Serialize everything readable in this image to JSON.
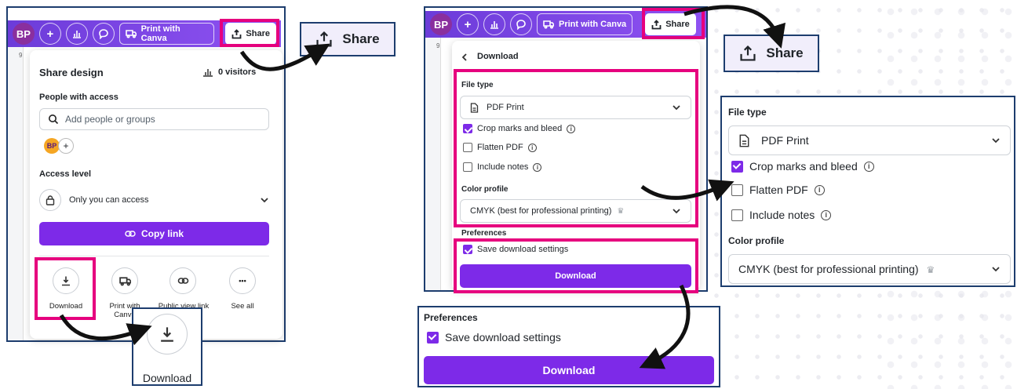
{
  "colors": {
    "accent": "#7d2ae8",
    "highlight": "#e6007e",
    "frame": "#1d3d6e",
    "topbar": "#7345e0"
  },
  "topbar": {
    "avatar": "BP",
    "add": "+",
    "print_label": "Print with Canva",
    "share_label": "Share"
  },
  "ruler_mark": "9",
  "share_panel": {
    "title": "Share design",
    "visitors": "0 visitors",
    "people_heading": "People with access",
    "search_placeholder": "Add people or groups",
    "chip_initials": "BP",
    "chip_add": "+",
    "access_heading": "Access level",
    "access_value": "Only you can access",
    "copy_link": "Copy link",
    "options": [
      {
        "label": "Download",
        "icon": "download-icon"
      },
      {
        "label": "Print with Canva",
        "icon": "truck-icon"
      },
      {
        "label": "Public view link",
        "icon": "link-icon"
      },
      {
        "label": "See all",
        "icon": "more-icon"
      }
    ]
  },
  "zoom_download": {
    "label": "Download"
  },
  "zoom_share": {
    "label": "Share"
  },
  "download_panel": {
    "title": "Download",
    "file_type_heading": "File type",
    "file_type_value": "PDF Print",
    "crop_marks": "Crop marks and bleed",
    "flatten_pdf": "Flatten PDF",
    "include_notes": "Include notes",
    "color_profile_heading": "Color profile",
    "color_profile_value": "CMYK (best for professional printing)",
    "preferences_heading": "Preferences",
    "save_settings": "Save download settings",
    "download_button": "Download",
    "crop_marks_checked": true,
    "flatten_pdf_checked": false,
    "include_notes_checked": false,
    "save_settings_checked": true
  },
  "zoom_file_type": {
    "heading": "File type",
    "value": "PDF Print",
    "crop_marks": "Crop marks and bleed",
    "flatten_pdf": "Flatten PDF",
    "include_notes": "Include notes",
    "color_heading": "Color profile",
    "color_value": "CMYK (best for professional printing)"
  },
  "zoom_preferences": {
    "heading": "Preferences",
    "save_settings": "Save download settings",
    "download_button": "Download"
  },
  "glyphs": {
    "info": "i",
    "crown": "♛",
    "more": "•••"
  }
}
